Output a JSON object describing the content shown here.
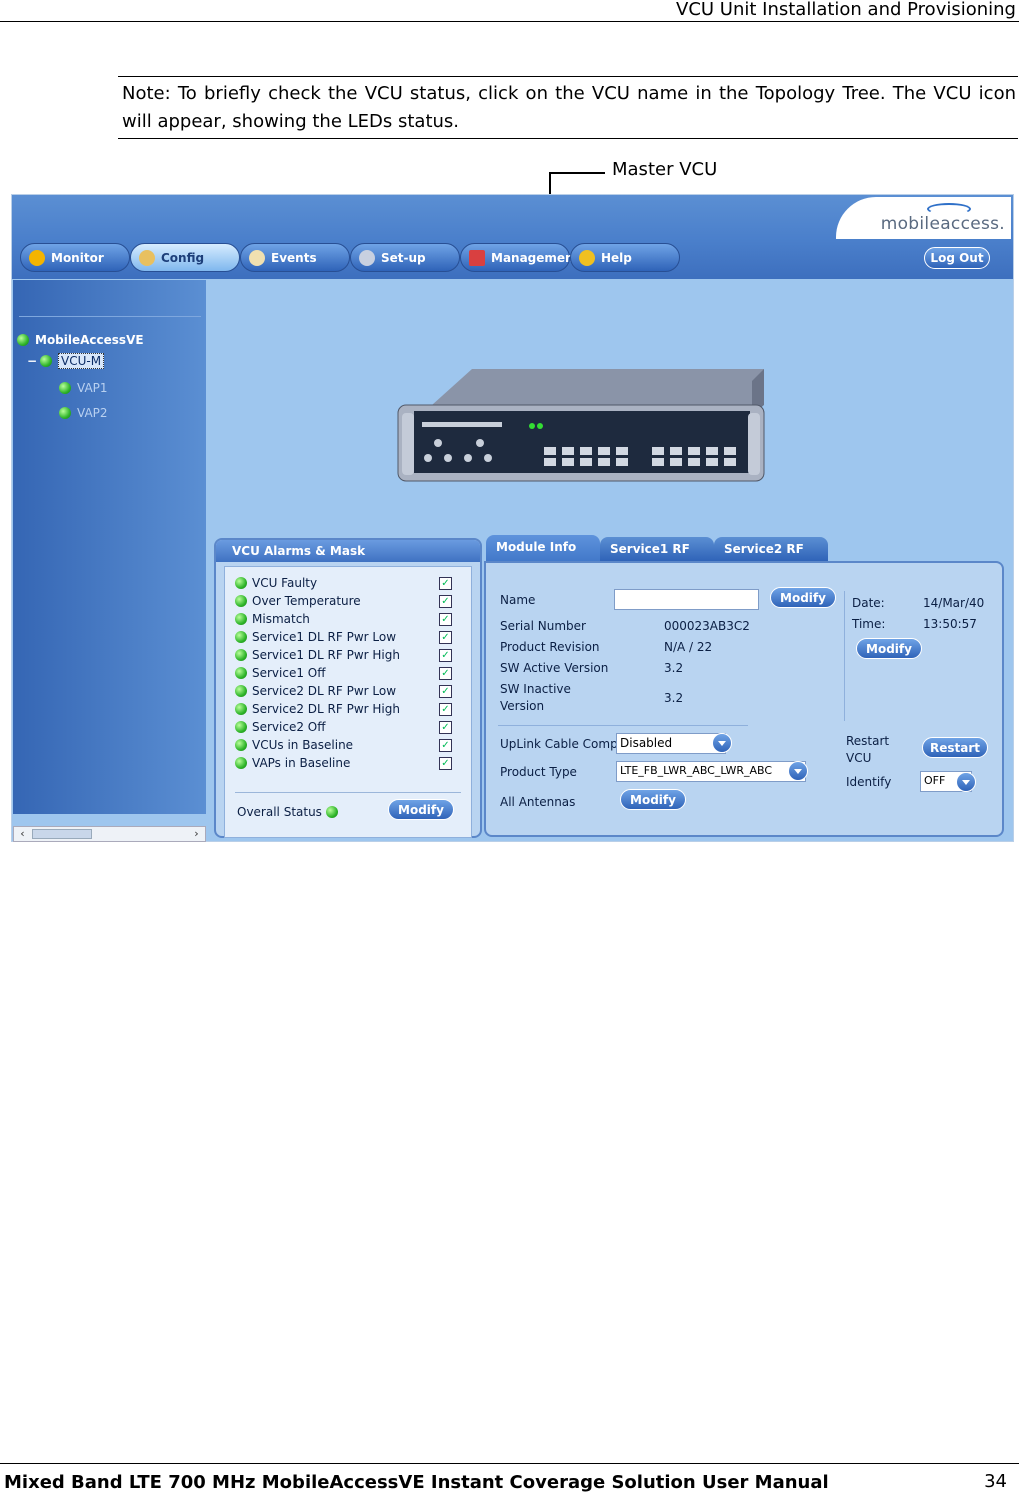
{
  "header": {
    "title": "VCU Unit Installation and Provisioning"
  },
  "note": {
    "text": "Note: To briefly check the VCU status, click on the VCU name in the Topology Tree. The VCU icon will appear, showing the LEDs status."
  },
  "callout": {
    "label": "Master VCU"
  },
  "app": {
    "logo": "mobileaccess.",
    "nav": [
      {
        "label": "Monitor",
        "icon": "monitor-icon"
      },
      {
        "label": "Config",
        "icon": "wrench-icon"
      },
      {
        "label": "Events",
        "icon": "events-icon"
      },
      {
        "label": "Set-up",
        "icon": "setup-icon"
      },
      {
        "label": "Management",
        "icon": "management-icon"
      },
      {
        "label": "Help",
        "icon": "help-icon"
      }
    ],
    "logout": "Log Out",
    "tree": {
      "root": "MobileAccessVE",
      "selected": "VCU-M",
      "children": [
        "VAP1",
        "VAP2"
      ]
    },
    "alarms": {
      "title": "VCU Alarms & Mask",
      "items": [
        "VCU Faulty",
        "Over Temperature",
        "Mismatch",
        "Service1 DL RF Pwr Low",
        "Service1 DL RF Pwr High",
        "Service1 Off",
        "Service2 DL RF Pwr Low",
        "Service2 DL RF Pwr High",
        "Service2 Off",
        "VCUs in Baseline",
        "VAPs in Baseline"
      ],
      "overall_label": "Overall Status",
      "modify": "Modify"
    },
    "module": {
      "tabs": [
        "Module Info",
        "Service1 RF",
        "Service2 RF"
      ],
      "name_label": "Name",
      "name_value": "",
      "modify": "Modify",
      "serial_label": "Serial Number",
      "serial_value": "000023AB3C2",
      "revision_label": "Product Revision",
      "revision_value": "N/A / 22",
      "sw_active_label": "SW Active Version",
      "sw_active_value": "3.2",
      "sw_inactive_label1": "SW Inactive",
      "sw_inactive_label2": "Version",
      "sw_inactive_value": "3.2",
      "date_label": "Date:",
      "date_value": "14/Mar/40",
      "time_label": "Time:",
      "time_value": "13:50:57",
      "uplink_label": "UpLink Cable Comp.",
      "uplink_value": "Disabled",
      "product_type_label": "Product Type",
      "product_type_value": "LTE_FB_LWR_ABC_LWR_ABC",
      "antennas_label": "All Antennas",
      "restart_label1": "Restart",
      "restart_label2": "VCU",
      "restart_button": "Restart",
      "identify_label": "Identify",
      "identify_value": "OFF"
    }
  },
  "footer": {
    "title": "Mixed Band LTE 700 MHz MobileAccessVE Instant Coverage Solution User Manual",
    "page": "34"
  }
}
